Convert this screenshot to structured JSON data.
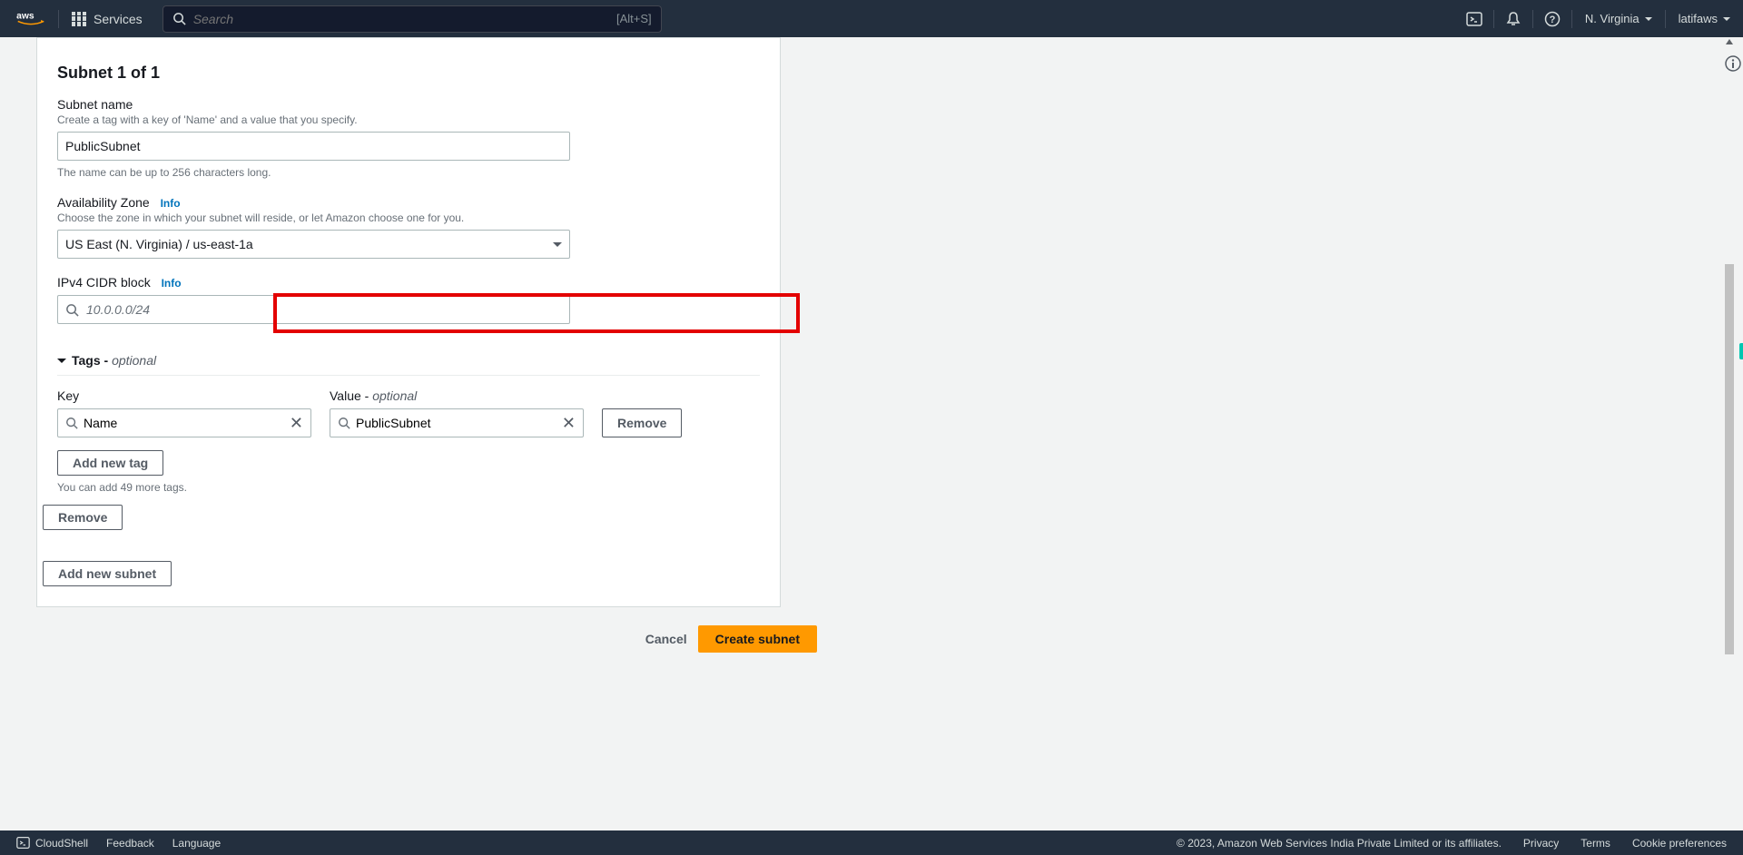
{
  "header": {
    "services_label": "Services",
    "search_placeholder": "Search",
    "search_hint": "[Alt+S]",
    "region": "N. Virginia",
    "account": "latifaws"
  },
  "page": {
    "subnet_heading": "Subnet 1 of 1",
    "subnet_name": {
      "label": "Subnet name",
      "desc": "Create a tag with a key of 'Name' and a value that you specify.",
      "value": "PublicSubnet",
      "hint": "The name can be up to 256 characters long."
    },
    "az": {
      "label": "Availability Zone",
      "info": "Info",
      "desc": "Choose the zone in which your subnet will reside, or let Amazon choose one for you.",
      "value": "US East (N. Virginia) / us-east-1a"
    },
    "cidr": {
      "label": "IPv4 CIDR block",
      "info": "Info",
      "placeholder": "10.0.0.0/24"
    },
    "tags": {
      "header_prefix": "Tags - ",
      "header_optional": "optional",
      "key_label": "Key",
      "value_label_prefix": "Value - ",
      "value_label_optional": "optional",
      "rows": [
        {
          "key": "Name",
          "value": "PublicSubnet"
        }
      ],
      "remove_label": "Remove",
      "add_tag_label": "Add new tag",
      "limit_hint": "You can add 49 more tags."
    },
    "remove_subnet_label": "Remove",
    "add_subnet_label": "Add new subnet",
    "cancel_label": "Cancel",
    "create_label": "Create subnet"
  },
  "footer": {
    "cloudshell": "CloudShell",
    "feedback": "Feedback",
    "language": "Language",
    "copyright": "© 2023, Amazon Web Services India Private Limited or its affiliates.",
    "privacy": "Privacy",
    "terms": "Terms",
    "cookies": "Cookie preferences"
  }
}
